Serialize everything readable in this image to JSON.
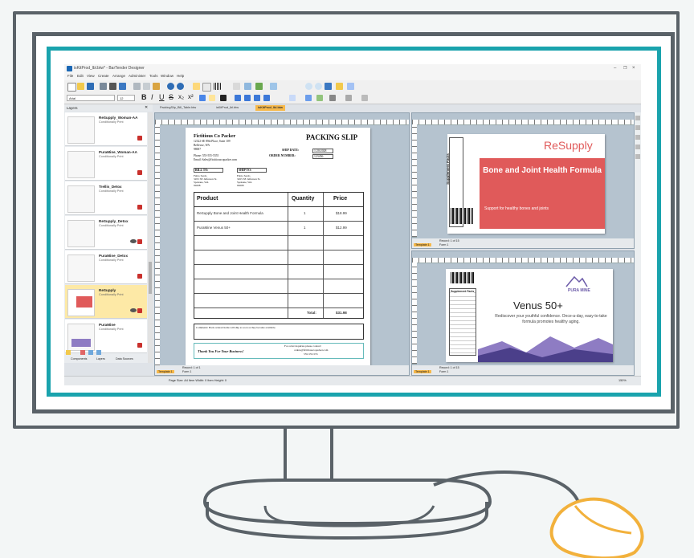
{
  "app": {
    "title": "isKitProd_lbl.btw* - BarTender Designer",
    "menu": [
      "File",
      "Edit",
      "View",
      "Create",
      "Arrange",
      "Administer",
      "Tools",
      "Window",
      "Help"
    ],
    "font_name": "Arial",
    "font_size": "12"
  },
  "left_panel": {
    "header": "Layers",
    "items": [
      {
        "name": "ReSupply_Woman-AA",
        "sub": "Conditionally Print",
        "selected": false,
        "eye": false
      },
      {
        "name": "PuraMine_Woman-AA",
        "sub": "Conditionally Print",
        "selected": false,
        "eye": false
      },
      {
        "name": "Trellis_Detox",
        "sub": "Conditionally Print",
        "selected": false,
        "eye": false
      },
      {
        "name": "ReSupply_Detox",
        "sub": "Conditionally Print",
        "selected": false,
        "eye": true
      },
      {
        "name": "PuraMine_Detox",
        "sub": "Conditionally Print",
        "selected": false,
        "eye": false
      },
      {
        "name": "ReSupply",
        "sub": "Conditionally Print",
        "selected": true,
        "eye": true
      },
      {
        "name": "PuraMine",
        "sub": "Conditionally Print",
        "selected": false,
        "eye": false
      }
    ],
    "bottom_tabs": [
      "Components",
      "Layers",
      "Data Sources"
    ]
  },
  "tabs": [
    "PackingSlip_Bill_Table.btw",
    "isKitProd_lbl.btw",
    "isKitProd_lbl.btw"
  ],
  "packing_slip": {
    "company": "Fictitious Co Packer",
    "address": [
      "12322 SE 89th Place, Suite 109",
      "Bellevue, WA",
      "98007"
    ],
    "phone": "Phone: 555-555-5555",
    "email": "Email: Sales@fictitiouscopacker.com",
    "title": "PACKING SLIP",
    "ship_date_label": "SHIP DATE:",
    "ship_date": "1/20/2028",
    "order_label": "ORDER NUMBER:",
    "order_number": "123456",
    "bill_to": "BILL TO:",
    "ship_to": "SHIP TO:",
    "bill_address": [
      "Fabio Sardo",
      "3455 SE Jefferson St.",
      "Spokane, WA",
      "99208"
    ],
    "ship_address": [
      "Fabio Sardo",
      "3455 SE Jefferson St.",
      "Spokane, WA",
      "99208"
    ],
    "headers": [
      "Product",
      "Quantity",
      "Price"
    ],
    "rows": [
      {
        "product": "ReSupply Bone and Joint Health Formula",
        "qty": "1",
        "price": "$18.99"
      },
      {
        "product": "PuraMine Venus 50+",
        "qty": "1",
        "price": "$12.99"
      }
    ],
    "total_label": "Total:",
    "total": "$31.98",
    "comments": "Comments: Back ordered items will ship as soon as they become available.",
    "thanks": "Thank You For Your Business!",
    "inquiries": [
      "For order inquiries please contact:",
      "orders@fictitiouscopacker.com",
      "555-555-555"
    ]
  },
  "resupply_label": {
    "brand": "ReSupply",
    "heading": "Bone and Joint Health Formula",
    "tagline": "Support for healthy bones and joints",
    "facts": "Supplement Facts"
  },
  "venus_label": {
    "brand": "PURA MINE",
    "heading": "Venus 50+",
    "tagline": "Rediscover your youthful confidence. Once-a-day, easy-to-take formula promotes healthy aging.",
    "facts": "Supplement Facts"
  },
  "pane_status": {
    "left_record": "Record: 1 of 1",
    "top_record": "Record: 1 of 15",
    "bottom_record": "Record: 1 of 15",
    "template": "Template 1",
    "form": "Form 1"
  },
  "status_bar": {
    "text": "Page Size: A4   Item Width: 0   Item Height: 0",
    "zoom": "150%"
  },
  "colors": {
    "accent_teal": "#1aa3ad",
    "monitor_gray": "#5a6268",
    "resupply_red": "#e05a5a",
    "venus_purple": "#6b5aa8",
    "selection_yellow": "#fde9a6",
    "mouse_orange": "#f2b13c"
  }
}
